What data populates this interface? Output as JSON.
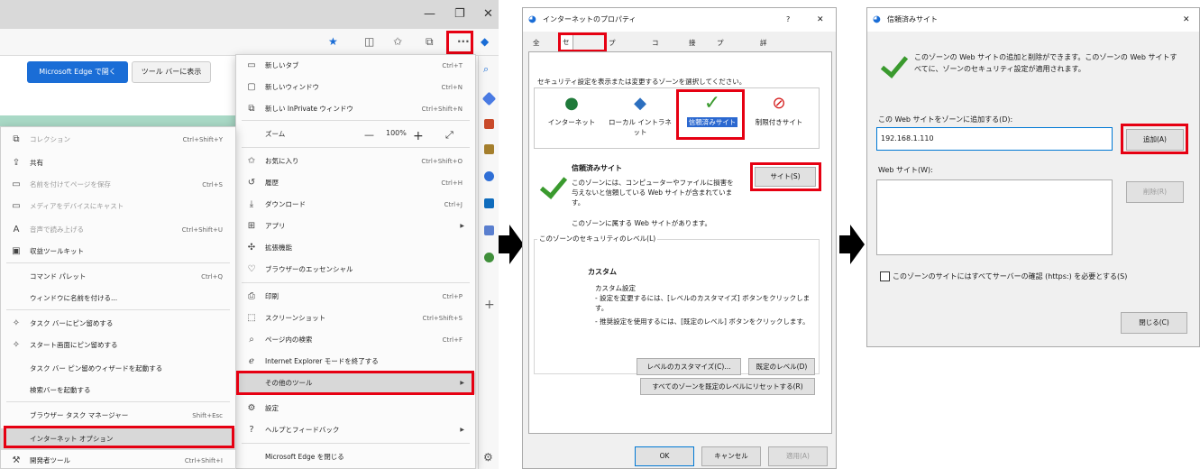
{
  "edge": {
    "window_controls": [
      "—",
      "❐",
      "✕"
    ],
    "page_buttons": {
      "open_in_edge": "Microsoft Edge で開く",
      "show_toolbar": "ツール バーに表示"
    },
    "settings_menu": [
      {
        "icon": "new-tab-icon",
        "glyph": "▭",
        "label": "新しいタブ",
        "shortcut": "Ctrl+T"
      },
      {
        "icon": "new-window-icon",
        "glyph": "▢",
        "label": "新しいウィンドウ",
        "shortcut": "Ctrl+N"
      },
      {
        "icon": "inprivate-icon",
        "glyph": "⧉",
        "label": "新しい InPrivate ウィンドウ",
        "shortcut": "Ctrl+Shift+N"
      },
      {
        "icon": "zoom-icon",
        "glyph": "",
        "label": "ズーム",
        "shortcut": ""
      },
      {
        "icon": "favorites-icon",
        "glyph": "✩",
        "label": "お気に入り",
        "shortcut": "Ctrl+Shift+O"
      },
      {
        "icon": "history-icon",
        "glyph": "↺",
        "label": "履歴",
        "shortcut": "Ctrl+H"
      },
      {
        "icon": "download-icon",
        "glyph": "⤓",
        "label": "ダウンロード",
        "shortcut": "Ctrl+J"
      },
      {
        "icon": "apps-icon",
        "glyph": "⊞",
        "label": "アプリ",
        "shortcut": ""
      },
      {
        "icon": "extensions-icon",
        "glyph": "✣",
        "label": "拡張機能",
        "shortcut": ""
      },
      {
        "icon": "essentials-icon",
        "glyph": "♡",
        "label": "ブラウザーのエッセンシャル",
        "shortcut": ""
      },
      {
        "icon": "print-icon",
        "glyph": "⎙",
        "label": "印刷",
        "shortcut": "Ctrl+P"
      },
      {
        "icon": "screenshot-icon",
        "glyph": "⬚",
        "label": "スクリーンショット",
        "shortcut": "Ctrl+Shift+S"
      },
      {
        "icon": "find-icon",
        "glyph": "⌕",
        "label": "ページ内の検索",
        "shortcut": "Ctrl+F"
      },
      {
        "icon": "ie-mode-icon",
        "glyph": "ℯ",
        "label": "Internet Explorer モードを終了する",
        "shortcut": ""
      },
      {
        "icon": "more-tools-icon",
        "glyph": "",
        "label": "その他のツール",
        "shortcut": ""
      },
      {
        "icon": "settings-icon",
        "glyph": "⚙",
        "label": "設定",
        "shortcut": ""
      },
      {
        "icon": "help-icon",
        "glyph": "?",
        "label": "ヘルプとフィードバック",
        "shortcut": ""
      },
      {
        "icon": "",
        "glyph": "",
        "label": "Microsoft Edge を閉じる",
        "shortcut": ""
      }
    ],
    "zoom": {
      "minus": "—",
      "value": "100%",
      "plus": "+",
      "fullscreen": "⤢"
    },
    "submenu": [
      {
        "icon": "collections-icon",
        "glyph": "⧉",
        "label": "コレクション",
        "shortcut": "Ctrl+Shift+Y"
      },
      {
        "icon": "share-icon",
        "glyph": "⇪",
        "label": "共有",
        "shortcut": ""
      },
      {
        "icon": "save-page-icon",
        "glyph": "▭",
        "label": "名前を付けてページを保存",
        "shortcut": "Ctrl+S"
      },
      {
        "icon": "cast-icon",
        "glyph": "▭",
        "label": "メディアをデバイスにキャスト",
        "shortcut": ""
      },
      {
        "icon": "read-aloud-icon",
        "glyph": "A",
        "label": "音声で読み上げる",
        "shortcut": "Ctrl+Shift+U"
      },
      {
        "icon": "revenue-toolkit-icon",
        "glyph": "▣",
        "label": "収益ツールキット",
        "shortcut": ""
      },
      {
        "icon": "",
        "glyph": "",
        "label": "コマンド パレット",
        "shortcut": "Ctrl+Q"
      },
      {
        "icon": "",
        "glyph": "",
        "label": "ウィンドウに名前を付ける...",
        "shortcut": ""
      },
      {
        "icon": "pin-taskbar-icon",
        "glyph": "✧",
        "label": "タスク バーにピン留めする",
        "shortcut": ""
      },
      {
        "icon": "pin-start-icon",
        "glyph": "✧",
        "label": "スタート画面にピン留めする",
        "shortcut": ""
      },
      {
        "icon": "",
        "glyph": "",
        "label": "タスク バー ピン留めウィザードを起動する",
        "shortcut": ""
      },
      {
        "icon": "",
        "glyph": "",
        "label": "検索バーを起動する",
        "shortcut": ""
      },
      {
        "icon": "",
        "glyph": "",
        "label": "ブラウザー タスク マネージャー",
        "shortcut": "Shift+Esc"
      },
      {
        "icon": "",
        "glyph": "",
        "label": "インターネット オプション",
        "shortcut": ""
      },
      {
        "icon": "devtools-icon",
        "glyph": "⚒",
        "label": "開発者ツール",
        "shortcut": "Ctrl+Shift+I"
      }
    ]
  },
  "inet_props": {
    "title": "インターネットのプロパティ",
    "help": "?",
    "close": "✕",
    "tabs": [
      "全般",
      "セキュリティ",
      "プライバシー",
      "コンテンツ",
      "接続",
      "プログラム",
      "詳細設定"
    ],
    "zone_prompt": "セキュリティ設定を表示または変更するゾーンを選択してください。",
    "zones": [
      {
        "icon": "globe-icon",
        "label": "インターネット"
      },
      {
        "icon": "intranet-icon",
        "label": "ローカル イントラネット"
      },
      {
        "icon": "trusted-check-icon",
        "label": "信頼済みサイト"
      },
      {
        "icon": "restricted-icon",
        "label": "制限付きサイト"
      }
    ],
    "zone_title": "信頼済みサイト",
    "zone_desc": "このゾーンには、コンピューターやファイルに損害を与えないと信頼している Web サイトが含まれています。",
    "sites_button": "サイト(S)",
    "zone_has_sites": "このゾーンに属する Web サイトがあります。",
    "level_group": "このゾーンのセキュリティのレベル(L)",
    "custom_title": "カスタム",
    "custom_lines": [
      "カスタム設定",
      "- 設定を変更するには、[レベルのカスタマイズ] ボタンをクリックします。",
      "- 推奨設定を使用するには、[既定のレベル] ボタンをクリックします。"
    ],
    "customize_button": "レベルのカスタマイズ(C)...",
    "default_button": "既定のレベル(D)",
    "reset_all_button": "すべてのゾーンを既定のレベルにリセットする(R)",
    "ok": "OK",
    "cancel": "キャンセル",
    "apply": "適用(A)"
  },
  "trusted": {
    "title": "信頼済みサイト",
    "close": "✕",
    "info": "このゾーンの Web サイトの追加と削除ができます。このゾーンの Web サイトすべてに、ゾーンのセキュリティ設定が適用されます。",
    "add_label": "この Web サイトをゾーンに追加する(D):",
    "add_value": "192.168.1.110",
    "add_button": "追加(A)",
    "sites_label": "Web サイト(W):",
    "remove_button": "削除(R)",
    "https_check": "このゾーンのサイトにはすべてサーバーの確認 (https:) を必要とする(S)",
    "close_button": "閉じる(C)"
  },
  "colors": {
    "highlight": "#e60012",
    "edge_blue": "#1a6dd6",
    "check_green": "#3a9a2e"
  }
}
